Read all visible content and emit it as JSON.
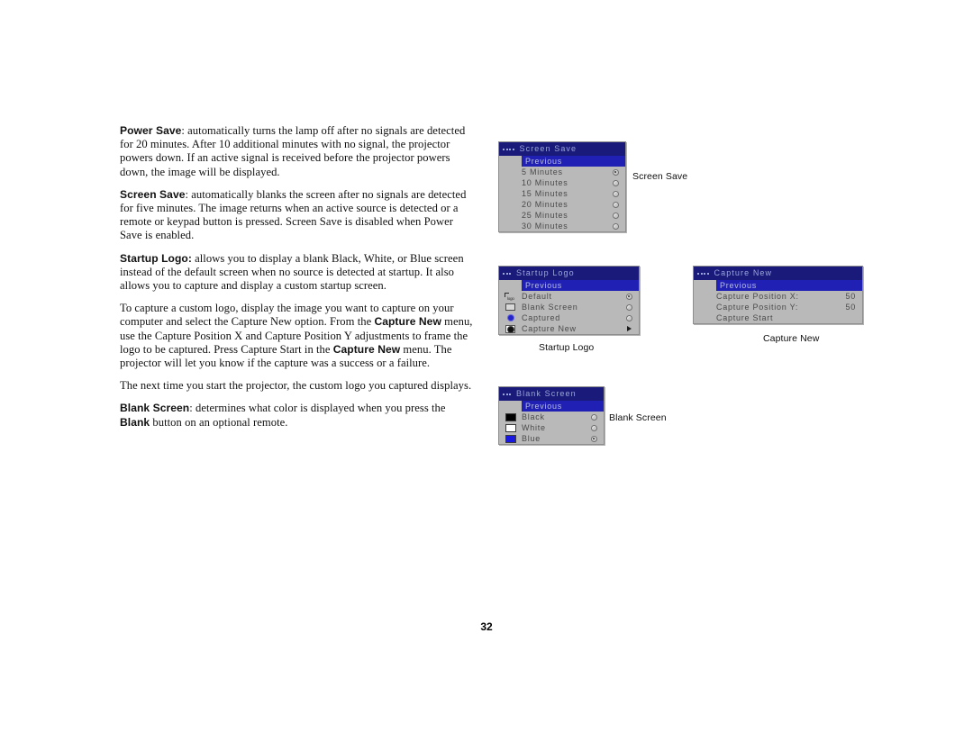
{
  "page": {
    "number": "32"
  },
  "body_text": {
    "paragraphs": [
      {
        "lead": "Power Save",
        "text": ": automatically turns the lamp off after no signals are detected for 20 minutes. After 10 additional minutes with no signal, the projector powers down. If an active signal is received before the projector powers down, the image will be displayed."
      },
      {
        "lead": "Screen Save",
        "text": ": automatically blanks the screen after no signals are detected for five minutes. The image returns when an active source is detected or a remote or keypad button is pressed. Screen Save is disabled when Power Save is enabled."
      },
      {
        "lead": "Startup Logo:",
        "text": " allows you to display a blank Black, White, or Blue screen instead of the default screen when no source is detected at startup. It also allows you to capture and display a custom startup screen."
      }
    ],
    "capture_paragraph": {
      "part1": "To capture a custom logo, display the image you want to capture on your computer and select the Capture New option. From the ",
      "bold1": "Capture New",
      "part2": " menu, use the Capture Position X and Capture Position Y adjustments to frame the logo to be captured. Press Capture Start in the ",
      "bold2": "Capture New",
      "part3": " menu. The projector will let you know if the capture was a success or a failure."
    },
    "next_time_paragraph": "The next time you start the projector, the custom logo you captured displays.",
    "blank_screen_paragraph": {
      "bold1": "Blank Screen",
      "part1": ": determines what color is displayed when you press the ",
      "bold2": "Blank",
      "part2": " button on an optional remote."
    }
  },
  "menus": {
    "screen_save": {
      "title": "Screen Save",
      "dots": 4,
      "caption": "Screen Save",
      "previous_label": "Previous",
      "rows": [
        {
          "label": "5 Minutes",
          "selected": true
        },
        {
          "label": "10 Minutes",
          "selected": false
        },
        {
          "label": "15 Minutes",
          "selected": false
        },
        {
          "label": "20 Minutes",
          "selected": false
        },
        {
          "label": "25 Minutes",
          "selected": false
        },
        {
          "label": "30 Minutes",
          "selected": false
        }
      ]
    },
    "startup_logo": {
      "title": "Startup Logo",
      "dots": 3,
      "caption": "Startup Logo",
      "previous_label": "Previous",
      "rows": [
        {
          "label": "Default",
          "icon": "logo-icon",
          "control": "radio",
          "selected": true
        },
        {
          "label": "Blank Screen",
          "icon": "rectangle-icon",
          "control": "radio",
          "selected": false
        },
        {
          "label": "Captured",
          "icon": "blue-burst-icon",
          "control": "radio",
          "selected": false
        },
        {
          "label": "Capture New",
          "icon": "black-burst-icon",
          "control": "arrow",
          "selected": false
        }
      ]
    },
    "capture_new": {
      "title": "Capture New",
      "dots": 4,
      "caption": "Capture New",
      "previous_label": "Previous",
      "rows": [
        {
          "label": "Capture Position X:",
          "value": "50"
        },
        {
          "label": "Capture Position Y:",
          "value": "50"
        },
        {
          "label": "Capture Start",
          "value": ""
        }
      ]
    },
    "blank_screen": {
      "title": "Blank Screen",
      "dots": 3,
      "caption": "Blank Screen",
      "previous_label": "Previous",
      "rows": [
        {
          "label": "Black",
          "swatch": "#000000",
          "selected": false
        },
        {
          "label": "White",
          "swatch": "#ffffff",
          "selected": false
        },
        {
          "label": "Blue",
          "swatch": "#1818e0",
          "selected": true
        }
      ]
    }
  },
  "colors": {
    "osd_titlebar": "#1a1a7a",
    "osd_titletext": "#9aa6d8",
    "osd_background": "#b9b9b9",
    "osd_highlight": "#2020b4",
    "osd_highlight_text": "#b8bfe8",
    "osd_text": "#4a4a4a"
  }
}
